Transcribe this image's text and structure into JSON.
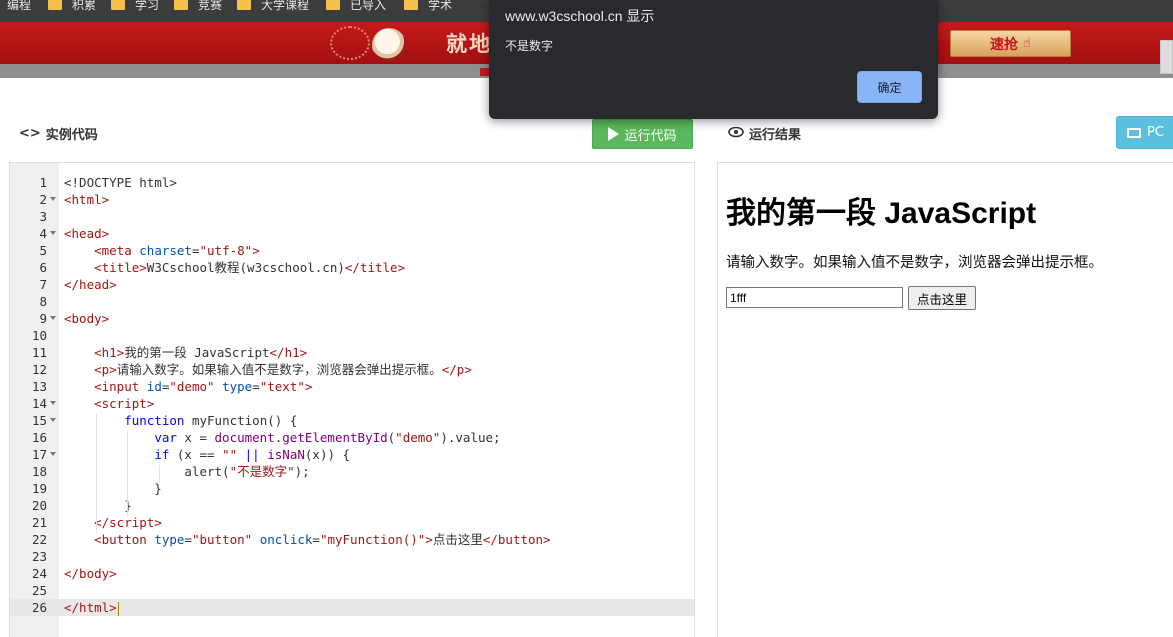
{
  "bookmarks": [
    {
      "label": "编程"
    },
    {
      "label": "积累"
    },
    {
      "label": "学习"
    },
    {
      "label": "竞赛"
    },
    {
      "label": "大学课程"
    },
    {
      "label": "已导入"
    },
    {
      "label": "学术"
    }
  ],
  "banner": {
    "slogan": "就地",
    "cta_label": "速抢",
    "cta_icon": "pointing-hand-icon",
    "accent": "#c51a1a"
  },
  "toolbar": {
    "code_title": "实例代码",
    "code_title_icon": "code-brackets-icon",
    "run_label": "运行代码",
    "result_title": "运行结果",
    "result_title_icon": "eye-icon",
    "pc_label": "PC"
  },
  "editor": {
    "active_line": 26,
    "lines": [
      {
        "n": "1",
        "html": "&lt;!DOCTYPE html&gt;"
      },
      {
        "n": "2",
        "fold": true,
        "html": "<span class=\"t\">&lt;html&gt;</span>"
      },
      {
        "n": "3",
        "html": ""
      },
      {
        "n": "4",
        "fold": true,
        "html": "<span class=\"t\">&lt;head&gt;</span>"
      },
      {
        "n": "5",
        "html": "    <span class=\"t\">&lt;meta</span> <span class=\"a\">charset</span>=<span class=\"v\">\"utf-8\"</span><span class=\"t\">&gt;</span>"
      },
      {
        "n": "6",
        "html": "    <span class=\"t\">&lt;title&gt;</span>W3Cschool教程(w3cschool.cn)<span class=\"t\">&lt;/title&gt;</span>"
      },
      {
        "n": "7",
        "html": "<span class=\"t\">&lt;/head&gt;</span>"
      },
      {
        "n": "8",
        "html": ""
      },
      {
        "n": "9",
        "fold": true,
        "html": "<span class=\"t\">&lt;body&gt;</span>"
      },
      {
        "n": "10",
        "html": ""
      },
      {
        "n": "11",
        "html": "    <span class=\"t\">&lt;h1&gt;</span>我的第一段 JavaScript<span class=\"t\">&lt;/h1&gt;</span>"
      },
      {
        "n": "12",
        "html": "    <span class=\"t\">&lt;p&gt;</span>请输入数字。如果输入值不是数字，浏览器会弹出提示框。<span class=\"t\">&lt;/p&gt;</span>"
      },
      {
        "n": "13",
        "html": "    <span class=\"t\">&lt;input</span> <span class=\"a\">id</span>=<span class=\"v\">\"demo\"</span> <span class=\"a\">type</span>=<span class=\"v\">\"text\"</span><span class=\"t\">&gt;</span>"
      },
      {
        "n": "14",
        "fold": true,
        "html": "    <span class=\"t\">&lt;script&gt;</span>"
      },
      {
        "n": "15",
        "fold": true,
        "html": "        <span class=\"k\">function</span> myFunction() {"
      },
      {
        "n": "16",
        "html": "            <span class=\"k\">var</span> x = <span class=\"c\">document</span>.<span class=\"c\">getElementById</span>(<span class=\"v\">\"demo\"</span>).value;"
      },
      {
        "n": "17",
        "fold": true,
        "html": "            <span class=\"k\">if</span> (x == <span class=\"v\">\"\"</span> <span class=\"k\">||</span> <span class=\"c\">isNaN</span>(x)) {"
      },
      {
        "n": "18",
        "html": "                alert(<span class=\"v\">\"不是数字\"</span>);"
      },
      {
        "n": "19",
        "html": "            }"
      },
      {
        "n": "20",
        "html": "        }"
      },
      {
        "n": "21",
        "html": "    <span class=\"t\">&lt;/script&gt;</span>"
      },
      {
        "n": "22",
        "html": "    <span class=\"t\">&lt;button</span> <span class=\"a\">type</span>=<span class=\"v\">\"button\"</span> <span class=\"a\">onclick</span>=<span class=\"v\">\"myFunction()\"</span><span class=\"t\">&gt;</span>点击这里<span class=\"t\">&lt;/button&gt;</span>"
      },
      {
        "n": "23",
        "html": ""
      },
      {
        "n": "24",
        "html": "<span class=\"t\">&lt;/body&gt;</span>"
      },
      {
        "n": "25",
        "html": ""
      },
      {
        "n": "26",
        "html": "<span class=\"t\">&lt;/html&gt;</span>"
      }
    ]
  },
  "result": {
    "heading": "我的第一段 JavaScript",
    "paragraph": "请输入数字。如果输入值不是数字，浏览器会弹出提示框。",
    "input_value": "1fff",
    "button_label": "点击这里"
  },
  "dialog": {
    "title": "www.w3cschool.cn 显示",
    "message": "不是数字",
    "ok_label": "确定"
  }
}
